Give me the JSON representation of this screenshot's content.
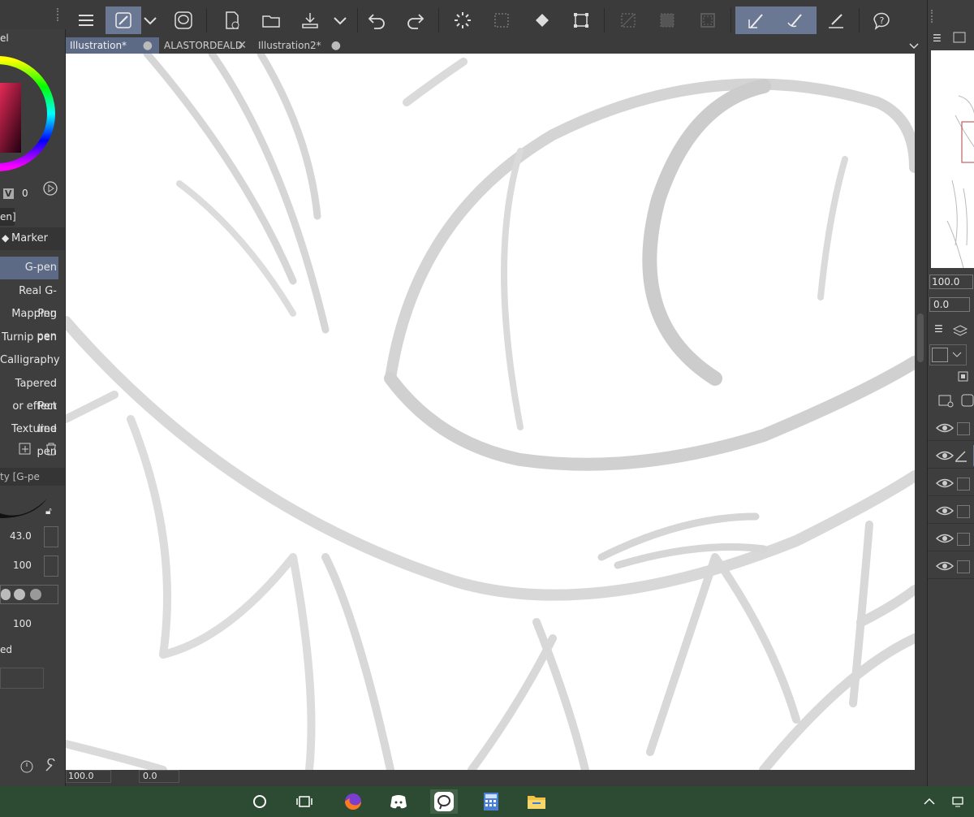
{
  "tabs": [
    {
      "label": "Illustration*",
      "active": true
    },
    {
      "label": "ALASTORDEALD",
      "active": false
    },
    {
      "label": "Illustration2*",
      "active": false
    }
  ],
  "left_panel": {
    "panel_title_fragment": "el",
    "color_v_label": "V",
    "color_v_value": "0",
    "subtool_tab_fragment": "en]",
    "brush_group": "Marker",
    "brushes": [
      "G-pen",
      "Real G-Pen",
      "Mapping pen",
      "Turnip pen",
      "Calligraphy",
      "Tapered Pen",
      "or effect line",
      "Textured pen"
    ],
    "property_title": "ty [G-pe",
    "brush_size": "43.0",
    "opacity": "100",
    "density": "100",
    "label_fragment": "ed"
  },
  "status": {
    "zoom": "100.0",
    "rotation": "0.0"
  },
  "right_panel": {
    "nav_zoom": "100.0",
    "nav_rotation": "0.0",
    "layer_count": 6
  },
  "colors": {
    "accent": "#5d6a86",
    "panel_bg": "#3e3e3e",
    "canvas_bg": "#ffffff",
    "stroke": "#d6d6d6",
    "taskbar": "#2d4a32"
  },
  "toolbar_icons": [
    "menu-icon",
    "pen-tool-icon",
    "chevron-down-icon",
    "lasso-icon",
    "new-file-icon",
    "open-folder-icon",
    "export-icon",
    "chevron-down-icon",
    "undo-icon",
    "redo-icon",
    "loading-icon",
    "selection-icon",
    "fill-icon",
    "transform-icon",
    "clear-icon",
    "fill-selection-icon",
    "deselect-icon",
    "stabilizer-icon",
    "brush-icon",
    "ruler-icon",
    "help-icon"
  ],
  "taskbar_icons": [
    "cortana-icon",
    "task-view-icon",
    "firefox-icon",
    "discord-icon",
    "clip-studio-icon",
    "calculator-icon",
    "file-explorer-icon",
    "show-hidden-icons",
    "network-icon"
  ]
}
